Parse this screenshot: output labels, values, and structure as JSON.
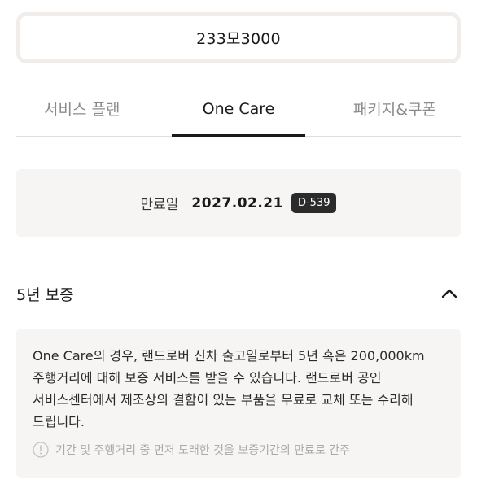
{
  "vehicle": {
    "plate_number": "233모3000"
  },
  "tabs": [
    {
      "label": "서비스 플랜",
      "active": false
    },
    {
      "label": "One Care",
      "active": true
    },
    {
      "label": "패키지&쿠폰",
      "active": false
    }
  ],
  "expiry": {
    "label": "만료일",
    "date": "2027.02.21",
    "dday": "D-539"
  },
  "warranty": {
    "title": "5년 보증",
    "expanded": true,
    "description": "One Care의 경우, 랜드로버 신차 출고일로부터 5년 혹은 200,000km 주행거리에 대해 보증 서비스를 받을 수 있습니다. 랜드로버 공인 서비스센터에서 제조상의 결함이 있는 부품을 무료로 교체 또는 수리해 드립니다.",
    "note": "기간 및 주행거리 중 먼저 도래한 것을 보증기간의 만료로 간주",
    "note_icon": "info-icon",
    "toggle_icon": "chevron-up-icon"
  },
  "colors": {
    "card_background": "#f7f5f3",
    "vehicle_border": "#f1edea",
    "active_tab": "#1a1a1a",
    "inactive_tab": "#8b8b8b",
    "dday_badge": "#2b2b2b"
  }
}
